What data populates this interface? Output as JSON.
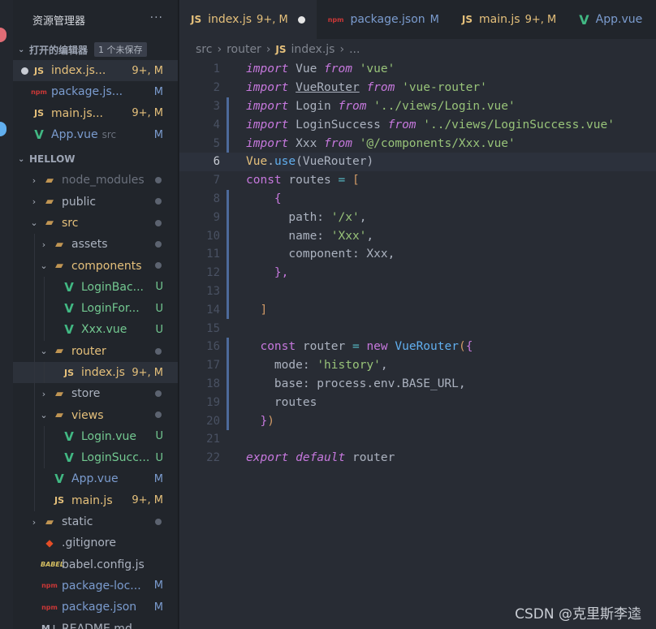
{
  "explorer": {
    "title": "资源管理器",
    "more_icon": "ellipsis-icon",
    "open_editors": {
      "label": "打开的编辑器",
      "badge": "1 个未保存",
      "items": [
        {
          "icon": "js",
          "name": "index.js...",
          "status": "9+, M",
          "cls": "mod",
          "dot": true
        },
        {
          "icon": "npm",
          "name": "package.js...",
          "status": "M",
          "cls": "plainblue"
        },
        {
          "icon": "js",
          "name": "main.js...",
          "status": "9+, M",
          "cls": "mod"
        },
        {
          "icon": "vue",
          "name": "App.vue",
          "desc": "src",
          "status": "M",
          "cls": "plainblue"
        }
      ]
    },
    "project": {
      "label": "HELLOW",
      "tree": [
        {
          "depth": 0,
          "tw": "›",
          "icon": "folder",
          "name": "node_modules",
          "cls": "ign",
          "dot": true
        },
        {
          "depth": 0,
          "tw": "›",
          "icon": "folder",
          "name": "public",
          "cls": "plain",
          "dot": true
        },
        {
          "depth": 0,
          "tw": "⌄",
          "icon": "folder",
          "name": "src",
          "cls": "mod",
          "dot": true
        },
        {
          "depth": 1,
          "tw": "›",
          "icon": "folder",
          "name": "assets",
          "cls": "plain",
          "dot": true
        },
        {
          "depth": 1,
          "tw": "⌄",
          "icon": "folder",
          "name": "components",
          "cls": "mod",
          "dot": true
        },
        {
          "depth": 2,
          "tw": "",
          "icon": "vue",
          "name": "LoginBac...",
          "cls": "new",
          "status": "U",
          "scls": "new"
        },
        {
          "depth": 2,
          "tw": "",
          "icon": "vue",
          "name": "LoginFor...",
          "cls": "new",
          "status": "U",
          "scls": "new"
        },
        {
          "depth": 2,
          "tw": "",
          "icon": "vue",
          "name": "Xxx.vue",
          "cls": "new",
          "status": "U",
          "scls": "new"
        },
        {
          "depth": 1,
          "tw": "⌄",
          "icon": "folder",
          "name": "router",
          "cls": "mod",
          "dot": true
        },
        {
          "depth": 2,
          "tw": "",
          "icon": "js",
          "name": "index.js",
          "cls": "mod",
          "status": "9+, M",
          "scls": "mod",
          "active": true
        },
        {
          "depth": 1,
          "tw": "›",
          "icon": "folder",
          "name": "store",
          "cls": "plain",
          "dot": true
        },
        {
          "depth": 1,
          "tw": "⌄",
          "icon": "folder",
          "name": "views",
          "cls": "mod",
          "dot": true
        },
        {
          "depth": 2,
          "tw": "",
          "icon": "vue",
          "name": "Login.vue",
          "cls": "new",
          "status": "U",
          "scls": "new"
        },
        {
          "depth": 2,
          "tw": "",
          "icon": "vue",
          "name": "LoginSucc...",
          "cls": "new",
          "status": "U",
          "scls": "new"
        },
        {
          "depth": 1,
          "tw": "",
          "icon": "vue",
          "name": "App.vue",
          "cls": "plainblue",
          "status": "M",
          "scls": "blue"
        },
        {
          "depth": 1,
          "tw": "",
          "icon": "js",
          "name": "main.js",
          "cls": "mod",
          "status": "9+, M",
          "scls": "mod"
        },
        {
          "depth": 0,
          "tw": "›",
          "icon": "folder",
          "name": "static",
          "cls": "plain",
          "dot": true
        },
        {
          "depth": 0,
          "tw": "",
          "icon": "git",
          "name": ".gitignore",
          "cls": "plain"
        },
        {
          "depth": 0,
          "tw": "",
          "icon": "babel",
          "name": "babel.config.js",
          "cls": "plain"
        },
        {
          "depth": 0,
          "tw": "",
          "icon": "npm",
          "name": "package-loc...",
          "cls": "plainblue",
          "status": "M",
          "scls": "blue"
        },
        {
          "depth": 0,
          "tw": "",
          "icon": "npm",
          "name": "package.json",
          "cls": "plainblue",
          "status": "M",
          "scls": "blue"
        },
        {
          "depth": 0,
          "tw": "",
          "icon": "md",
          "name": "README.md",
          "cls": "plain"
        }
      ]
    }
  },
  "tabs": [
    {
      "icon": "js",
      "label": "index.js",
      "status": "9+, M",
      "cls": "mod",
      "active": true,
      "dirty": true
    },
    {
      "icon": "npm",
      "label": "package.json",
      "status": "M",
      "cls": "modb"
    },
    {
      "icon": "js",
      "label": "main.js",
      "status": "9+, M",
      "cls": "mod"
    },
    {
      "icon": "vue",
      "label": "App.vue",
      "status": "",
      "cls": "modb"
    }
  ],
  "breadcrumb": [
    "src",
    "router",
    "index.js",
    "..."
  ],
  "code": {
    "current_line": 6,
    "lines": [
      {
        "n": "1",
        "t": [
          [
            "kw",
            "import"
          ],
          [
            "id",
            " Vue "
          ],
          [
            "kw",
            "from"
          ],
          [
            "id",
            " "
          ],
          [
            "str",
            "'vue'"
          ]
        ]
      },
      {
        "n": "2",
        "t": [
          [
            "kw",
            "import"
          ],
          [
            "id",
            " "
          ],
          [
            "idu",
            "VueRouter"
          ],
          [
            "id",
            " "
          ],
          [
            "kw",
            "from"
          ],
          [
            "id",
            " "
          ],
          [
            "str",
            "'vue-router'"
          ]
        ]
      },
      {
        "n": "3",
        "t": [
          [
            "kw",
            "import"
          ],
          [
            "id",
            " Login "
          ],
          [
            "kw",
            "from"
          ],
          [
            "id",
            " "
          ],
          [
            "str",
            "'../views/Login.vue'"
          ]
        ],
        "g": true
      },
      {
        "n": "4",
        "t": [
          [
            "kw",
            "import"
          ],
          [
            "id",
            " LoginSuccess "
          ],
          [
            "kw",
            "from"
          ],
          [
            "id",
            " "
          ],
          [
            "str",
            "'../views/LoginSuccess.vue'"
          ]
        ],
        "g": true
      },
      {
        "n": "5",
        "t": [
          [
            "kw",
            "import"
          ],
          [
            "id",
            " Xxx "
          ],
          [
            "kw",
            "from"
          ],
          [
            "id",
            " "
          ],
          [
            "str",
            "'@/components/Xxx.vue'"
          ]
        ],
        "g": true
      },
      {
        "n": "6",
        "t": [
          [
            "cls",
            "Vue"
          ],
          [
            "id",
            "."
          ],
          [
            "fn",
            "use"
          ],
          [
            "id",
            "(VueRouter)"
          ]
        ]
      },
      {
        "n": "7",
        "t": [
          [
            "kw2",
            "const"
          ],
          [
            "id",
            " routes "
          ],
          [
            "op",
            "="
          ],
          [
            "id",
            " "
          ],
          [
            "br1",
            "["
          ]
        ]
      },
      {
        "n": "8",
        "t": [
          [
            "id",
            "    "
          ],
          [
            "br2",
            "{"
          ]
        ],
        "g": true
      },
      {
        "n": "9",
        "t": [
          [
            "id",
            "      path: "
          ],
          [
            "str",
            "'/x'"
          ],
          [
            "id",
            ","
          ]
        ],
        "g": true
      },
      {
        "n": "10",
        "t": [
          [
            "id",
            "      name: "
          ],
          [
            "str",
            "'Xxx'"
          ],
          [
            "id",
            ","
          ]
        ],
        "g": true
      },
      {
        "n": "11",
        "t": [
          [
            "id",
            "      component: Xxx,"
          ]
        ],
        "g": true
      },
      {
        "n": "12",
        "t": [
          [
            "id",
            "    "
          ],
          [
            "br2",
            "},"
          ]
        ],
        "g": true
      },
      {
        "n": "13",
        "t": [
          [
            "id",
            ""
          ]
        ],
        "g": true
      },
      {
        "n": "14",
        "t": [
          [
            "id",
            "  "
          ],
          [
            "br1",
            "]"
          ]
        ],
        "g": true
      },
      {
        "n": "15",
        "t": [
          [
            "id",
            ""
          ]
        ]
      },
      {
        "n": "16",
        "t": [
          [
            "id",
            "  "
          ],
          [
            "kw2",
            "const"
          ],
          [
            "id",
            " router "
          ],
          [
            "op",
            "="
          ],
          [
            "id",
            " "
          ],
          [
            "kw2",
            "new"
          ],
          [
            "id",
            " "
          ],
          [
            "fn",
            "VueRouter"
          ],
          [
            "br1",
            "("
          ],
          [
            "br2",
            "{"
          ]
        ],
        "g": true
      },
      {
        "n": "17",
        "t": [
          [
            "id",
            "    mode: "
          ],
          [
            "str",
            "'history'"
          ],
          [
            "id",
            ","
          ]
        ],
        "g": true
      },
      {
        "n": "18",
        "t": [
          [
            "id",
            "    base: process.env.BASE_URL,"
          ]
        ],
        "g": true
      },
      {
        "n": "19",
        "t": [
          [
            "id",
            "    routes"
          ]
        ],
        "g": true
      },
      {
        "n": "20",
        "t": [
          [
            "id",
            "  "
          ],
          [
            "br2",
            "}"
          ],
          [
            "br1",
            ")"
          ]
        ],
        "g": true
      },
      {
        "n": "21",
        "t": [
          [
            "id",
            ""
          ]
        ]
      },
      {
        "n": "22",
        "t": [
          [
            "kw",
            "export"
          ],
          [
            "id",
            " "
          ],
          [
            "kw",
            "default"
          ],
          [
            "id",
            " router"
          ]
        ]
      }
    ]
  },
  "watermark": "CSDN @克里斯李逵",
  "colors": {
    "accent_js": "#e5c07b",
    "accent_vue": "#41b883",
    "untracked": "#73c991",
    "modified_blue": "#7b9ccf"
  }
}
